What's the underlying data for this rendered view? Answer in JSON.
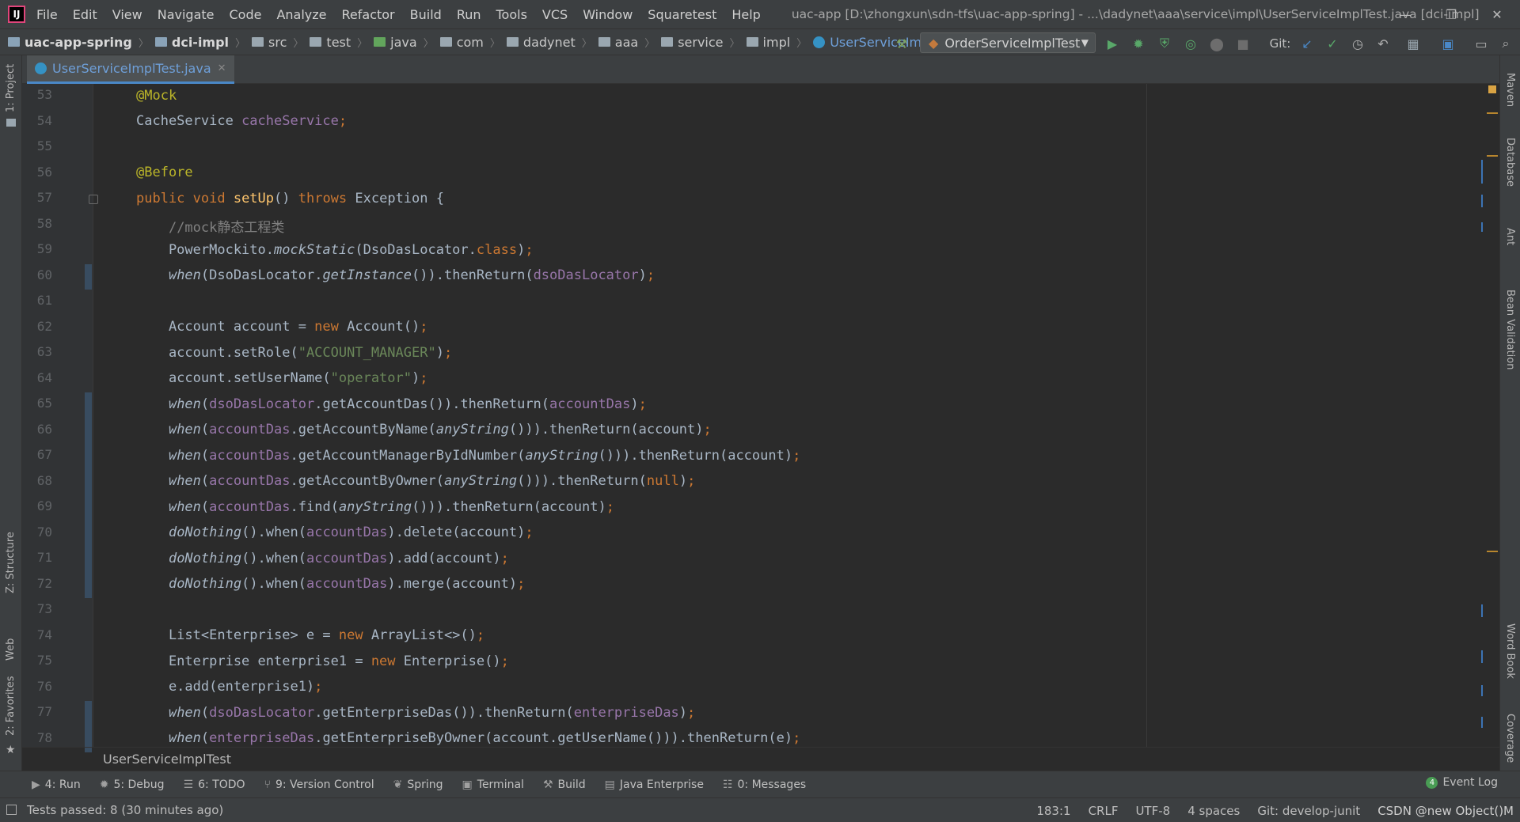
{
  "menubar": {
    "logo_text": "IJ",
    "items": [
      "File",
      "Edit",
      "View",
      "Navigate",
      "Code",
      "Analyze",
      "Refactor",
      "Build",
      "Run",
      "Tools",
      "VCS",
      "Window",
      "Squaretest",
      "Help"
    ],
    "window_title": "uac-app [D:\\zhongxun\\sdn-tfs\\uac-app-spring] - ...\\dadynet\\aaa\\service\\impl\\UserServiceImplTest.java [dci-impl]"
  },
  "navbar": {
    "crumbs": [
      "uac-app-spring",
      "dci-impl",
      "src",
      "test",
      "java",
      "com",
      "dadynet",
      "aaa",
      "service",
      "impl",
      "UserServiceImplTest"
    ],
    "run_config": "OrderServiceImplTest",
    "git_label": "Git:"
  },
  "editor": {
    "tab_label": "UserServiceImplTest.java",
    "footer_breadcrumb": "UserServiceImplTest",
    "line_numbers": [
      "53",
      "54",
      "55",
      "56",
      "57",
      "58",
      "59",
      "60",
      "61",
      "62",
      "63",
      "64",
      "65",
      "66",
      "67",
      "68",
      "69",
      "70",
      "71",
      "72",
      "73",
      "74",
      "75",
      "76",
      "77",
      "78"
    ]
  },
  "left_tools": [
    "1: Project",
    "Z: Structure",
    "Web",
    "2: Favorites"
  ],
  "right_tools": [
    "Maven",
    "Database",
    "Ant",
    "Bean Validation",
    "Word Book",
    "Coverage"
  ],
  "tool_windows": [
    {
      "icon": "▶",
      "label": "4: Run"
    },
    {
      "icon": "✹",
      "label": "5: Debug"
    },
    {
      "icon": "☰",
      "label": "6: TODO"
    },
    {
      "icon": "⑂",
      "label": "9: Version Control"
    },
    {
      "icon": "❦",
      "label": "Spring"
    },
    {
      "icon": "▣",
      "label": "Terminal"
    },
    {
      "icon": "⚒",
      "label": "Build"
    },
    {
      "icon": "▤",
      "label": "Java Enterprise"
    },
    {
      "icon": "☷",
      "label": "0: Messages"
    }
  ],
  "event_log": {
    "count": "4",
    "label": "Event Log"
  },
  "statusbar": {
    "message": "Tests passed: 8 (30 minutes ago)",
    "position": "183:1",
    "line_sep": "CRLF",
    "encoding": "UTF-8",
    "indent": "4 spaces",
    "git_branch": "Git: develop-junit",
    "watermark": "CSDN @new Object()M"
  },
  "colors": {
    "keyword": "#cc7832",
    "annotation": "#bbb529",
    "field": "#9876aa",
    "string": "#6a8759",
    "comment": "#808080",
    "method_decl": "#ffc66d",
    "text": "#a9b7c6"
  }
}
